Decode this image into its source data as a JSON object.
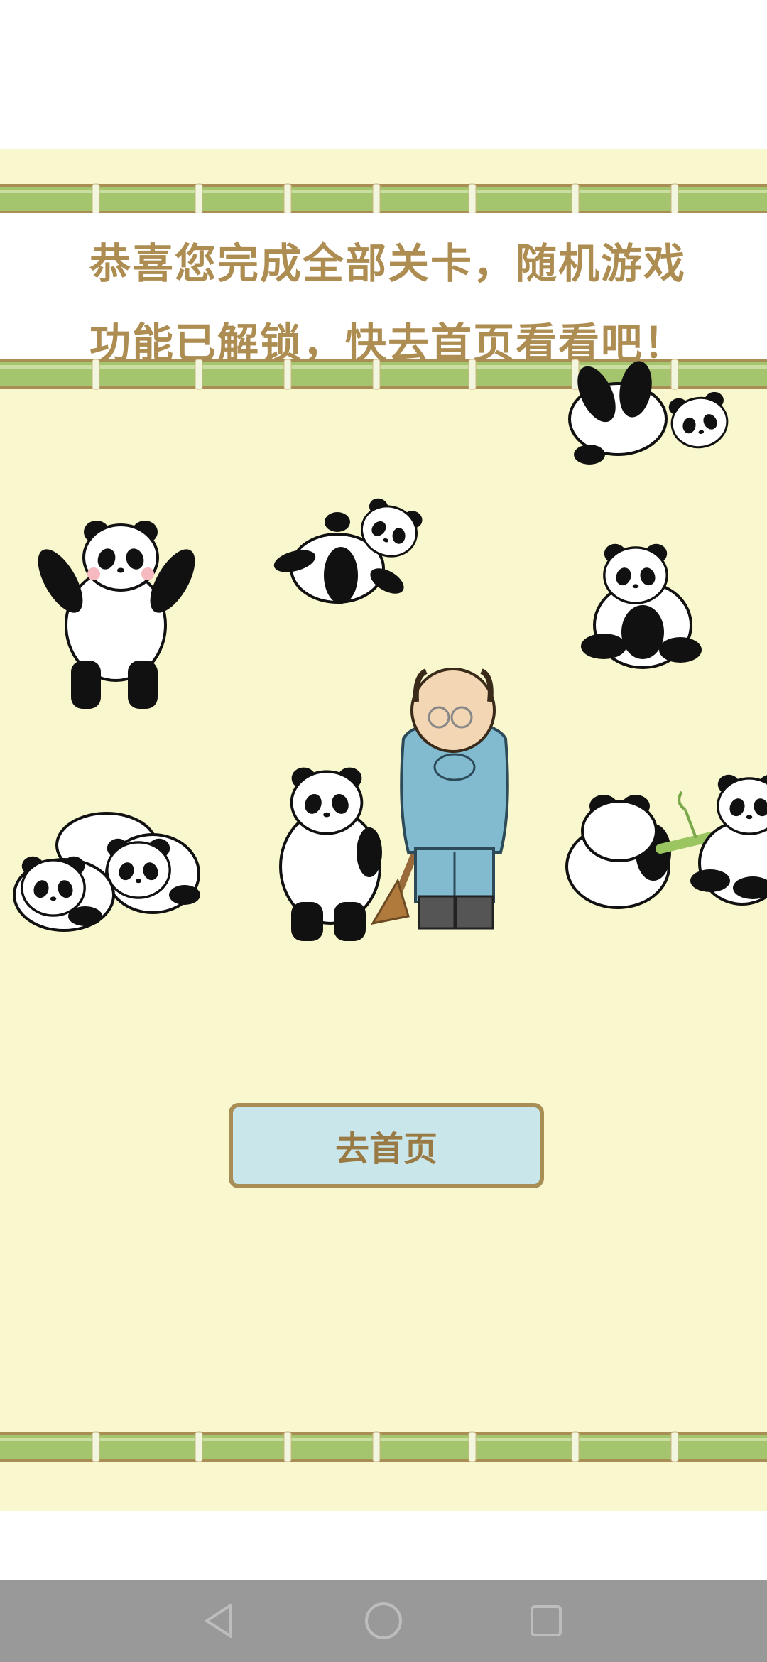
{
  "message": {
    "line1": "恭喜您完成全部关卡，随机游戏",
    "line2": "功能已解锁，快去首页看看吧！"
  },
  "home_button": {
    "label": "去首页"
  },
  "illustration": {
    "subjects": [
      "panda",
      "panda",
      "panda",
      "panda",
      "panda",
      "panda",
      "panda",
      "panda",
      "panda",
      "zookeeper-with-broom",
      "bamboo-stick"
    ]
  },
  "nav_bar": {
    "buttons": [
      "back-icon",
      "home-icon",
      "recents-icon"
    ]
  },
  "colors": {
    "background": "#f8f7cd",
    "message_text": "#ad8d52",
    "bamboo": "#a4c46e",
    "bamboo_edge": "#a88d55",
    "button_fill": "#c9e7ea",
    "button_border": "#a88d55",
    "nav_bar": "#999999"
  }
}
